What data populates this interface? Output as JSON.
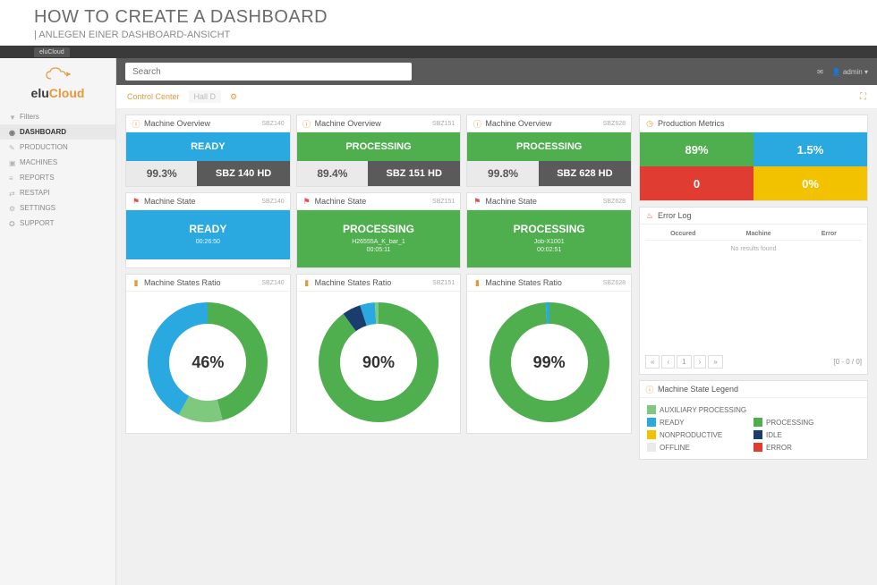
{
  "outer": {
    "title": "HOW TO CREATE A DASHBOARD",
    "subtitle": "| ANLEGEN EINER DASHBOARD-ANSICHT",
    "browser_tab": "eluCloud"
  },
  "logo": {
    "part1": "elu",
    "part2": "Cloud"
  },
  "nav": [
    {
      "label": "Filters",
      "active": false
    },
    {
      "label": "DASHBOARD",
      "active": true
    },
    {
      "label": "PRODUCTION",
      "active": false
    },
    {
      "label": "MACHINES",
      "active": false
    },
    {
      "label": "REPORTS",
      "active": false
    },
    {
      "label": "RESTAPI",
      "active": false
    },
    {
      "label": "SETTINGS",
      "active": false
    },
    {
      "label": "SUPPORT",
      "active": false
    }
  ],
  "search": {
    "placeholder": "Search"
  },
  "user": {
    "label": "admin"
  },
  "breadcrumbs": {
    "a": "Control Center",
    "b": "Hall D"
  },
  "overview": [
    {
      "tag": "SBZ140",
      "status": "READY",
      "pct": "99.3%",
      "name": "SBZ 140 HD",
      "class": "ready"
    },
    {
      "tag": "SBZ151",
      "status": "PROCESSING",
      "pct": "89.4%",
      "name": "SBZ 151 HD",
      "class": "processing"
    },
    {
      "tag": "SBZ628",
      "status": "PROCESSING",
      "pct": "99.8%",
      "name": "SBZ 628 HD",
      "class": "processing"
    }
  ],
  "overview_title": "Machine Overview",
  "state_title": "Machine State",
  "ratio_title": "Machine States Ratio",
  "states": [
    {
      "tag": "SBZ140",
      "status": "READY",
      "sub": "",
      "time": "00:26:50",
      "class": "ready"
    },
    {
      "tag": "SBZ151",
      "status": "PROCESSING",
      "sub": "H26555A_K_bar_1",
      "time": "00:05:11",
      "class": "processing"
    },
    {
      "tag": "SBZ628",
      "status": "PROCESSING",
      "sub": "Job-X1001",
      "time": "00:02:51",
      "class": "processing"
    }
  ],
  "ratios": [
    {
      "tag": "SBZ140",
      "center": "46%"
    },
    {
      "tag": "SBZ151",
      "center": "90%"
    },
    {
      "tag": "SBZ628",
      "center": "99%"
    }
  ],
  "metrics_title": "Production Metrics",
  "metrics": {
    "m1": "89%",
    "m2": "1.5%",
    "m3": "0",
    "m4": "0%"
  },
  "errorlog": {
    "title": "Error Log",
    "cols": {
      "c1": "Occured",
      "c2": "Machine",
      "c3": "Error"
    },
    "empty": "No results found",
    "range": "[0 - 0 / 0]"
  },
  "legend": {
    "title": "Machine State Legend",
    "aux": "AUXILIARY PROCESSING",
    "ready": "READY",
    "proc": "PROCESSING",
    "nonprod": "NONPRODUCTIVE",
    "idle": "IDLE",
    "offline": "OFFLINE",
    "error": "ERROR"
  },
  "chart_data": [
    {
      "type": "pie",
      "title": "Machine States Ratio SBZ140",
      "series": [
        {
          "name": "PROCESSING",
          "value": 46,
          "color": "#4fae4e"
        },
        {
          "name": "AUXILIARY PROCESSING",
          "value": 12,
          "color": "#7fc97f"
        },
        {
          "name": "READY",
          "value": 42,
          "color": "#29a9e0"
        }
      ],
      "center_label": "46%"
    },
    {
      "type": "pie",
      "title": "Machine States Ratio SBZ151",
      "series": [
        {
          "name": "PROCESSING",
          "value": 90,
          "color": "#4fae4e"
        },
        {
          "name": "IDLE",
          "value": 5,
          "color": "#1a3d6d"
        },
        {
          "name": "READY",
          "value": 4,
          "color": "#29a9e0"
        },
        {
          "name": "AUXILIARY PROCESSING",
          "value": 1,
          "color": "#7fc97f"
        }
      ],
      "center_label": "90%"
    },
    {
      "type": "pie",
      "title": "Machine States Ratio SBZ628",
      "series": [
        {
          "name": "PROCESSING",
          "value": 99,
          "color": "#4fae4e"
        },
        {
          "name": "READY",
          "value": 1,
          "color": "#29a9e0"
        }
      ],
      "center_label": "99%"
    }
  ]
}
